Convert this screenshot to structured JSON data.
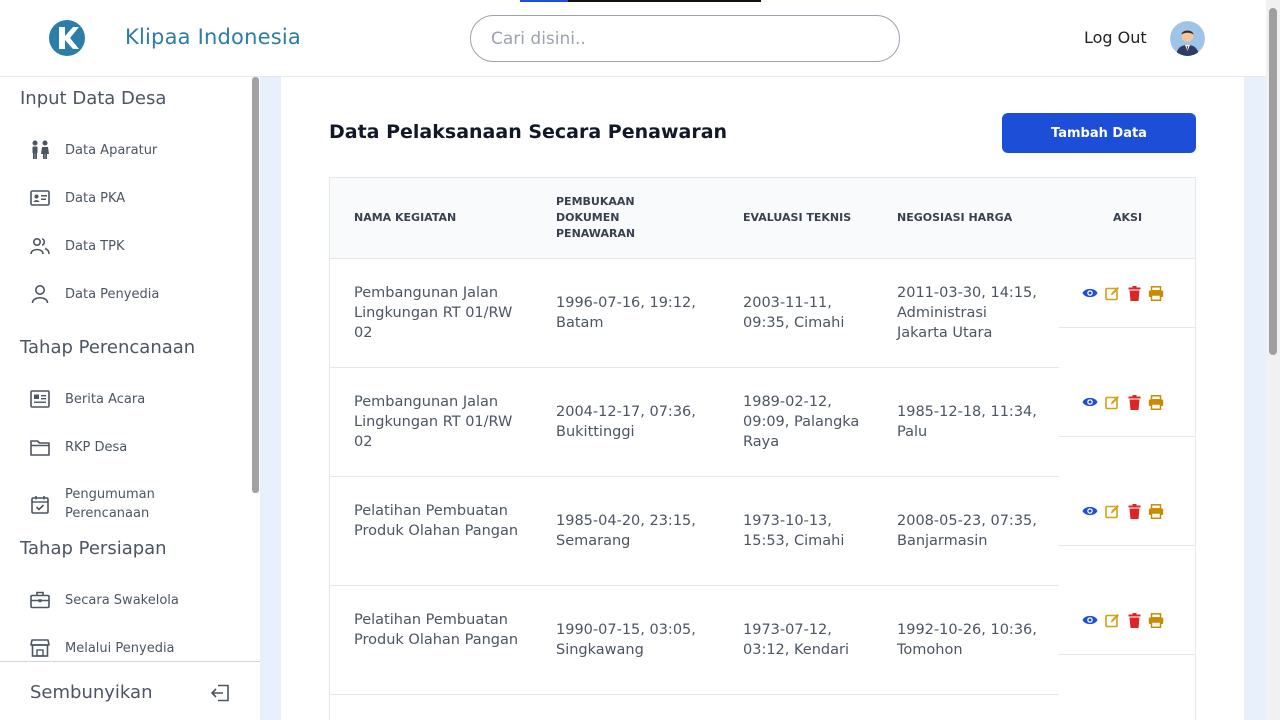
{
  "header": {
    "brand": "Klipaa Indonesia",
    "search_placeholder": "Cari disini..",
    "logout": "Log Out"
  },
  "sidebar": {
    "sections": [
      {
        "title": "Input Data Desa",
        "items": [
          {
            "label": "Data Aparatur",
            "icon": "people-icon"
          },
          {
            "label": "Data PKA",
            "icon": "id-card-icon"
          },
          {
            "label": "Data TPK",
            "icon": "users-icon"
          },
          {
            "label": "Data Penyedia",
            "icon": "user-icon"
          }
        ]
      },
      {
        "title": "Tahap Perencanaan",
        "items": [
          {
            "label": "Berita Acara",
            "icon": "newspaper-icon"
          },
          {
            "label": "RKP Desa",
            "icon": "folder-icon"
          },
          {
            "label": "Pengumuman Perencanaan",
            "icon": "calendar-check-icon"
          }
        ]
      },
      {
        "title": "Tahap Persiapan",
        "items": [
          {
            "label": "Secara Swakelola",
            "icon": "briefcase-icon"
          },
          {
            "label": "Melalui Penyedia",
            "icon": "store-icon"
          }
        ]
      }
    ],
    "hide_label": "Sembunyikan"
  },
  "main": {
    "title": "Data Pelaksanaan Secara Penawaran",
    "add_button": "Tambah Data",
    "columns": [
      "NAMA KEGIATAN",
      "PEMBUKAAN DOKUMEN PENAWARAN",
      "EVALUASI TEKNIS",
      "NEGOSIASI HARGA",
      "AKSI"
    ],
    "rows": [
      {
        "nama": "Pembangunan Jalan Lingkungan RT 01/RW 02",
        "pembukaan": "1996-07-16, 19:12, Batam",
        "evaluasi": "2003-11-11, 09:35, Cimahi",
        "negosiasi": "2011-03-30, 14:15, Administrasi Jakarta Utara"
      },
      {
        "nama": "Pembangunan Jalan Lingkungan RT 01/RW 02",
        "pembukaan": "2004-12-17, 07:36, Bukittinggi",
        "evaluasi": "1989-02-12, 09:09, Palangka Raya",
        "negosiasi": "1985-12-18, 11:34, Palu"
      },
      {
        "nama": "Pelatihan Pembuatan Produk Olahan Pangan",
        "pembukaan": "1985-04-20, 23:15, Semarang",
        "evaluasi": "1973-10-13, 15:53, Cimahi",
        "negosiasi": "2008-05-23, 07:35, Banjarmasin"
      },
      {
        "nama": "Pelatihan Pembuatan Produk Olahan Pangan",
        "pembukaan": "1990-07-15, 03:05, Singkawang",
        "evaluasi": "1973-07-12, 03:12, Kendari",
        "negosiasi": "1992-10-26, 10:36, Tomohon"
      }
    ],
    "action_icons": [
      "view-icon",
      "edit-icon",
      "delete-icon",
      "print-icon"
    ]
  },
  "colors": {
    "brand": "#2a7ea8",
    "primary_button": "#1d4ed8",
    "view": "#1d4ed8",
    "edit": "#d4a017",
    "delete": "#dc2626",
    "print": "#ca8a04"
  }
}
